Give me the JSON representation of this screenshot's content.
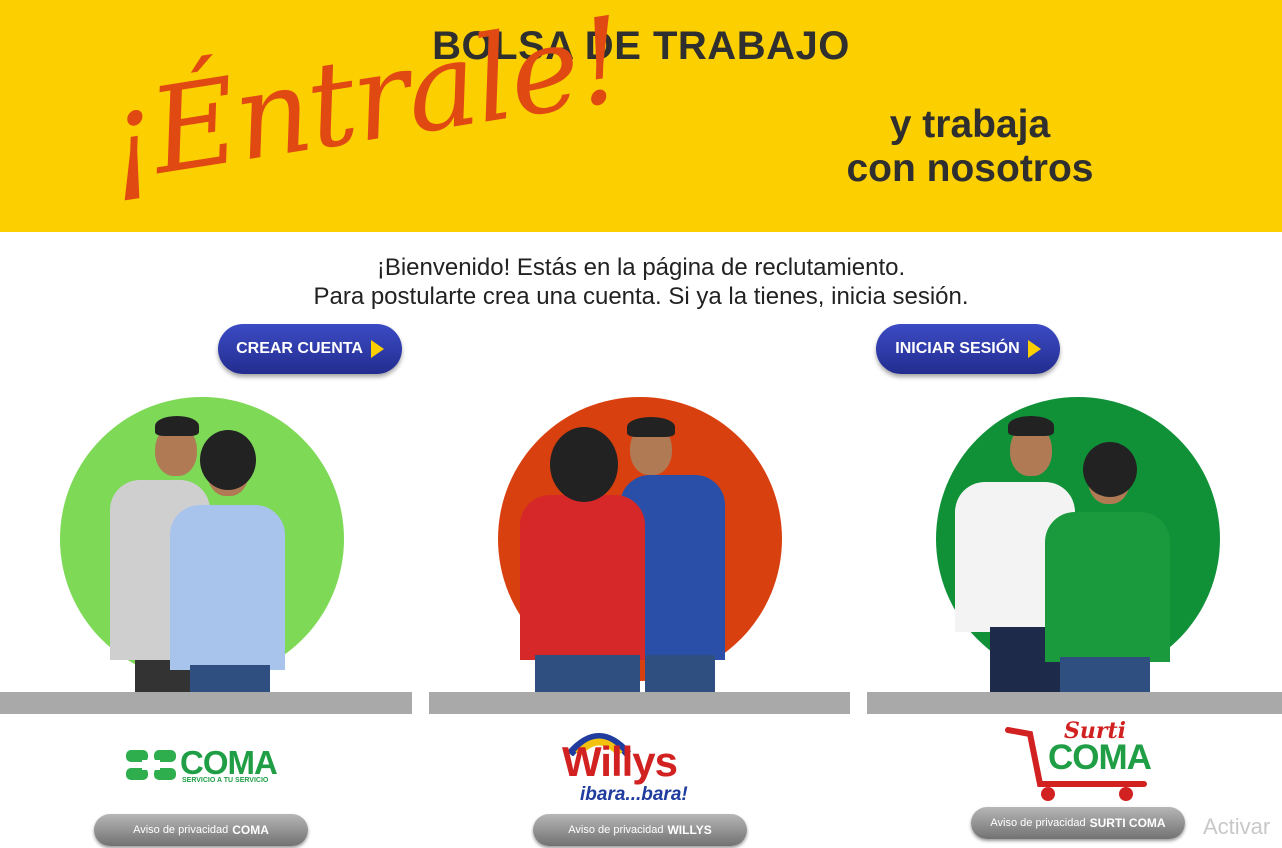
{
  "banner": {
    "title": "BOLSA DE TRABAJO",
    "headline": "¡Éntrale!",
    "tagline_line1": "y trabaja",
    "tagline_line2": "con nosotros"
  },
  "welcome": {
    "line1": "¡Bienvenido! Estás en la página de reclutamiento.",
    "line2": "Para postularte crea una cuenta. Si ya la tienes, inicia sesión."
  },
  "actions": {
    "create_account": "CREAR CUENTA",
    "sign_in": "INICIAR SESIÓN"
  },
  "brands": [
    {
      "logo_text": "COMA",
      "logo_sub": "SERVICIO A TU SERVICIO",
      "privacy_prefix": "Aviso de privacidad",
      "privacy_brand": "COMA",
      "color": "#7ed957"
    },
    {
      "logo_text": "Willys",
      "logo_sub": "ibara...bara!",
      "privacy_prefix": "Aviso de privacidad",
      "privacy_brand": "WILLYS",
      "color": "#d9400f"
    },
    {
      "logo_text": "COMA",
      "logo_top": "Surti",
      "privacy_prefix": "Aviso de privacidad",
      "privacy_brand": "SURTI COMA",
      "color": "#109138"
    }
  ],
  "watermark": "Activar",
  "colors": {
    "banner": "#fcd000",
    "headline": "#e04a12",
    "button": "#2a3499"
  }
}
